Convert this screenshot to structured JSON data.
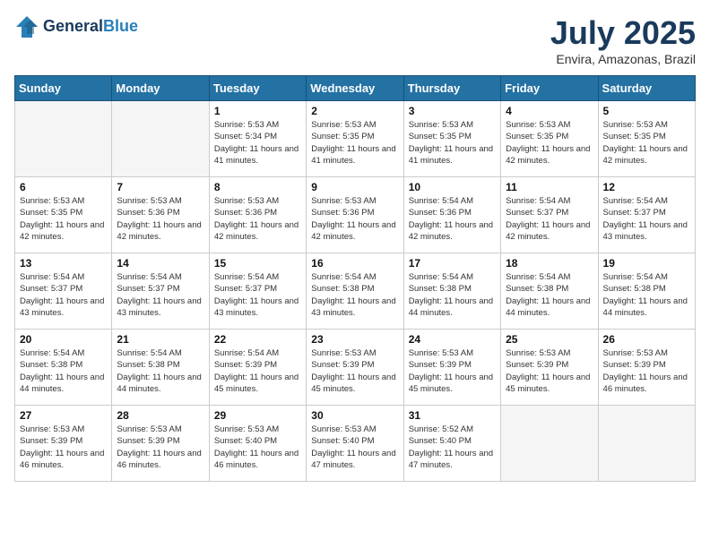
{
  "header": {
    "logo_line1": "General",
    "logo_line2": "Blue",
    "month": "July 2025",
    "location": "Envira, Amazonas, Brazil"
  },
  "weekdays": [
    "Sunday",
    "Monday",
    "Tuesday",
    "Wednesday",
    "Thursday",
    "Friday",
    "Saturday"
  ],
  "weeks": [
    [
      {
        "day": "",
        "detail": ""
      },
      {
        "day": "",
        "detail": ""
      },
      {
        "day": "1",
        "detail": "Sunrise: 5:53 AM\nSunset: 5:34 PM\nDaylight: 11 hours and 41 minutes."
      },
      {
        "day": "2",
        "detail": "Sunrise: 5:53 AM\nSunset: 5:35 PM\nDaylight: 11 hours and 41 minutes."
      },
      {
        "day": "3",
        "detail": "Sunrise: 5:53 AM\nSunset: 5:35 PM\nDaylight: 11 hours and 41 minutes."
      },
      {
        "day": "4",
        "detail": "Sunrise: 5:53 AM\nSunset: 5:35 PM\nDaylight: 11 hours and 42 minutes."
      },
      {
        "day": "5",
        "detail": "Sunrise: 5:53 AM\nSunset: 5:35 PM\nDaylight: 11 hours and 42 minutes."
      }
    ],
    [
      {
        "day": "6",
        "detail": "Sunrise: 5:53 AM\nSunset: 5:35 PM\nDaylight: 11 hours and 42 minutes."
      },
      {
        "day": "7",
        "detail": "Sunrise: 5:53 AM\nSunset: 5:36 PM\nDaylight: 11 hours and 42 minutes."
      },
      {
        "day": "8",
        "detail": "Sunrise: 5:53 AM\nSunset: 5:36 PM\nDaylight: 11 hours and 42 minutes."
      },
      {
        "day": "9",
        "detail": "Sunrise: 5:53 AM\nSunset: 5:36 PM\nDaylight: 11 hours and 42 minutes."
      },
      {
        "day": "10",
        "detail": "Sunrise: 5:54 AM\nSunset: 5:36 PM\nDaylight: 11 hours and 42 minutes."
      },
      {
        "day": "11",
        "detail": "Sunrise: 5:54 AM\nSunset: 5:37 PM\nDaylight: 11 hours and 42 minutes."
      },
      {
        "day": "12",
        "detail": "Sunrise: 5:54 AM\nSunset: 5:37 PM\nDaylight: 11 hours and 43 minutes."
      }
    ],
    [
      {
        "day": "13",
        "detail": "Sunrise: 5:54 AM\nSunset: 5:37 PM\nDaylight: 11 hours and 43 minutes."
      },
      {
        "day": "14",
        "detail": "Sunrise: 5:54 AM\nSunset: 5:37 PM\nDaylight: 11 hours and 43 minutes."
      },
      {
        "day": "15",
        "detail": "Sunrise: 5:54 AM\nSunset: 5:37 PM\nDaylight: 11 hours and 43 minutes."
      },
      {
        "day": "16",
        "detail": "Sunrise: 5:54 AM\nSunset: 5:38 PM\nDaylight: 11 hours and 43 minutes."
      },
      {
        "day": "17",
        "detail": "Sunrise: 5:54 AM\nSunset: 5:38 PM\nDaylight: 11 hours and 44 minutes."
      },
      {
        "day": "18",
        "detail": "Sunrise: 5:54 AM\nSunset: 5:38 PM\nDaylight: 11 hours and 44 minutes."
      },
      {
        "day": "19",
        "detail": "Sunrise: 5:54 AM\nSunset: 5:38 PM\nDaylight: 11 hours and 44 minutes."
      }
    ],
    [
      {
        "day": "20",
        "detail": "Sunrise: 5:54 AM\nSunset: 5:38 PM\nDaylight: 11 hours and 44 minutes."
      },
      {
        "day": "21",
        "detail": "Sunrise: 5:54 AM\nSunset: 5:38 PM\nDaylight: 11 hours and 44 minutes."
      },
      {
        "day": "22",
        "detail": "Sunrise: 5:54 AM\nSunset: 5:39 PM\nDaylight: 11 hours and 45 minutes."
      },
      {
        "day": "23",
        "detail": "Sunrise: 5:53 AM\nSunset: 5:39 PM\nDaylight: 11 hours and 45 minutes."
      },
      {
        "day": "24",
        "detail": "Sunrise: 5:53 AM\nSunset: 5:39 PM\nDaylight: 11 hours and 45 minutes."
      },
      {
        "day": "25",
        "detail": "Sunrise: 5:53 AM\nSunset: 5:39 PM\nDaylight: 11 hours and 45 minutes."
      },
      {
        "day": "26",
        "detail": "Sunrise: 5:53 AM\nSunset: 5:39 PM\nDaylight: 11 hours and 46 minutes."
      }
    ],
    [
      {
        "day": "27",
        "detail": "Sunrise: 5:53 AM\nSunset: 5:39 PM\nDaylight: 11 hours and 46 minutes."
      },
      {
        "day": "28",
        "detail": "Sunrise: 5:53 AM\nSunset: 5:39 PM\nDaylight: 11 hours and 46 minutes."
      },
      {
        "day": "29",
        "detail": "Sunrise: 5:53 AM\nSunset: 5:40 PM\nDaylight: 11 hours and 46 minutes."
      },
      {
        "day": "30",
        "detail": "Sunrise: 5:53 AM\nSunset: 5:40 PM\nDaylight: 11 hours and 47 minutes."
      },
      {
        "day": "31",
        "detail": "Sunrise: 5:52 AM\nSunset: 5:40 PM\nDaylight: 11 hours and 47 minutes."
      },
      {
        "day": "",
        "detail": ""
      },
      {
        "day": "",
        "detail": ""
      }
    ]
  ]
}
